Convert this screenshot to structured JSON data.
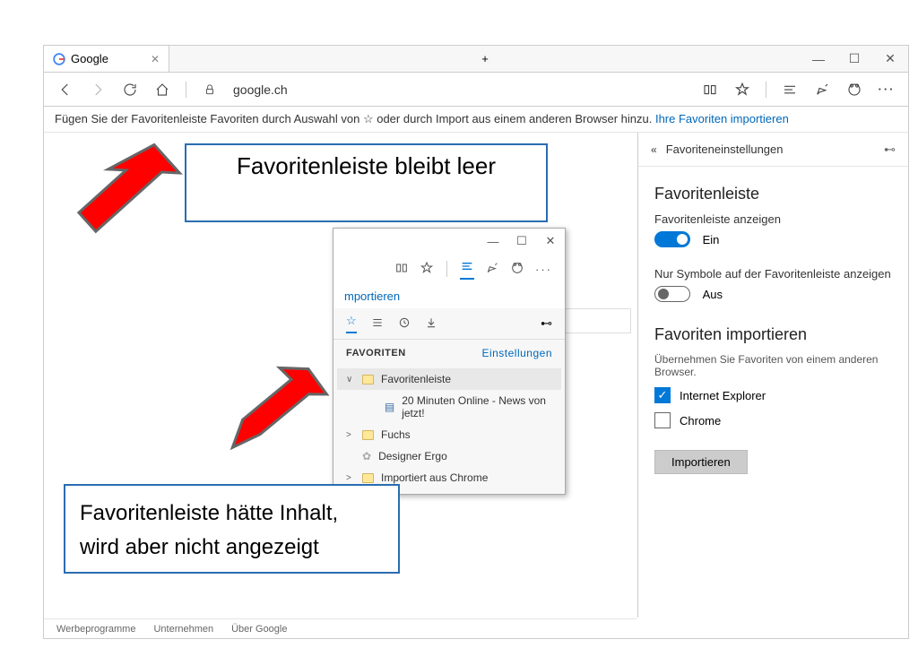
{
  "window": {
    "min": "—",
    "max": "☐",
    "close": "✕"
  },
  "tab": {
    "title": "Google",
    "close": "✕",
    "plus": "+"
  },
  "toolbar": {
    "url": "google.ch"
  },
  "favbar": {
    "msg": "Fügen Sie der Favoritenleiste Favoriten durch Auswahl von ☆ oder durch Import aus einem anderen Browser hinzu.",
    "link": "Ihre Favoriten importieren"
  },
  "box1": "Favoritenleiste bleibt leer",
  "box2_l1": "Favoritenleiste hätte Inhalt,",
  "box2_l2": "wird aber nicht angezeigt",
  "sub": {
    "imp": "mportieren",
    "head": "FAVORITEN",
    "settings": "Einstellungen",
    "tree": [
      {
        "caret": "∨",
        "icon": "folder",
        "label": "Favoritenleiste"
      },
      {
        "caret": "",
        "icon": "page",
        "label": "20 Minuten Online - News von jetzt!",
        "indent": true
      },
      {
        "caret": ">",
        "icon": "folder",
        "label": "Fuchs"
      },
      {
        "caret": "",
        "icon": "gear",
        "label": "Designer Ergo"
      },
      {
        "caret": ">",
        "icon": "folder",
        "label": "Importiert aus Chrome"
      }
    ]
  },
  "settings": {
    "title": "Favoriteneinstellungen",
    "h1": "Favoritenleiste",
    "show_label": "Favoritenleiste anzeigen",
    "on": "Ein",
    "icons_label": "Nur Symbole auf der Favoritenleiste anzeigen",
    "off": "Aus",
    "h2": "Favoriten importieren",
    "sub": "Übernehmen Sie Favoriten von einem anderen Browser.",
    "ie": "Internet Explorer",
    "chrome": "Chrome",
    "btn": "Importieren"
  },
  "footer": {
    "a": "Werbeprogramme",
    "b": "Unternehmen",
    "c": "Über Google"
  }
}
